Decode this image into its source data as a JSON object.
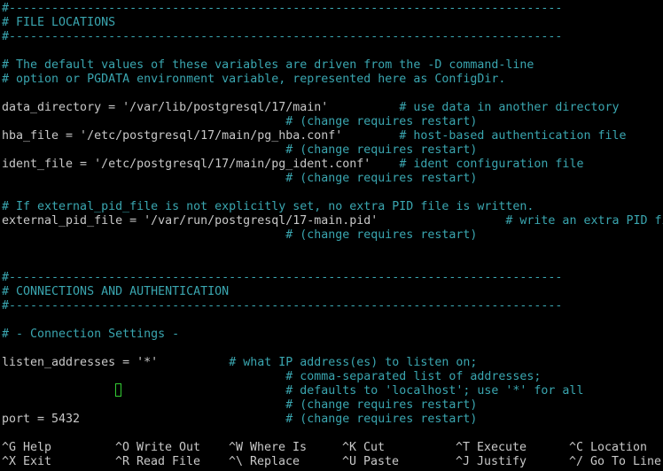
{
  "editor": {
    "lines": [
      {
        "row": 0,
        "type": "comment",
        "text": "#------------------------------------------------------------------------------"
      },
      {
        "row": 1,
        "type": "comment",
        "text": "# FILE LOCATIONS"
      },
      {
        "row": 2,
        "type": "comment",
        "text": "#------------------------------------------------------------------------------"
      },
      {
        "row": 3,
        "type": "blank",
        "text": ""
      },
      {
        "row": 4,
        "type": "comment",
        "text": "# The default values of these variables are driven from the -D command-line"
      },
      {
        "row": 5,
        "type": "comment",
        "text": "# option or PGDATA environment variable, represented here as ConfigDir."
      },
      {
        "row": 6,
        "type": "blank",
        "text": ""
      },
      {
        "row": 7,
        "type": "setting",
        "code": "data_directory = '/var/lib/postgresql/17/main'          ",
        "comment": "# use data in another directory"
      },
      {
        "row": 8,
        "type": "setting",
        "code": "                                        ",
        "comment": "# (change requires restart)"
      },
      {
        "row": 9,
        "type": "setting",
        "code": "hba_file = '/etc/postgresql/17/main/pg_hba.conf'        ",
        "comment": "# host-based authentication file"
      },
      {
        "row": 10,
        "type": "setting",
        "code": "                                        ",
        "comment": "# (change requires restart)"
      },
      {
        "row": 11,
        "type": "setting",
        "code": "ident_file = '/etc/postgresql/17/main/pg_ident.conf'    ",
        "comment": "# ident configuration file"
      },
      {
        "row": 12,
        "type": "setting",
        "code": "                                        ",
        "comment": "# (change requires restart)"
      },
      {
        "row": 13,
        "type": "blank",
        "text": ""
      },
      {
        "row": 14,
        "type": "comment",
        "text": "# If external_pid_file is not explicitly set, no extra PID file is written."
      },
      {
        "row": 15,
        "type": "setting",
        "code": "external_pid_file = '/var/run/postgresql/17-main.pid'                  ",
        "comment": "# write an extra PID file"
      },
      {
        "row": 16,
        "type": "setting",
        "code": "                                        ",
        "comment": "# (change requires restart)"
      },
      {
        "row": 17,
        "type": "blank",
        "text": ""
      },
      {
        "row": 18,
        "type": "blank",
        "text": ""
      },
      {
        "row": 19,
        "type": "comment",
        "text": "#------------------------------------------------------------------------------"
      },
      {
        "row": 20,
        "type": "comment",
        "text": "# CONNECTIONS AND AUTHENTICATION"
      },
      {
        "row": 21,
        "type": "comment",
        "text": "#------------------------------------------------------------------------------"
      },
      {
        "row": 22,
        "type": "blank",
        "text": ""
      },
      {
        "row": 23,
        "type": "comment",
        "text": "# - Connection Settings -"
      },
      {
        "row": 24,
        "type": "blank",
        "text": ""
      },
      {
        "row": 25,
        "type": "setting",
        "code": "listen_addresses = '*'          ",
        "comment": "# what IP address(es) to listen on;"
      },
      {
        "row": 26,
        "type": "setting",
        "code": "                                        ",
        "comment": "# comma-separated list of addresses;"
      },
      {
        "row": 27,
        "type": "setting",
        "code": "                                        ",
        "comment": "# defaults to 'localhost'; use '*' for all"
      },
      {
        "row": 28,
        "type": "setting",
        "code": "                                        ",
        "comment": "# (change requires restart)"
      },
      {
        "row": 29,
        "type": "setting",
        "code": "port = 5432                             ",
        "comment": "# (change requires restart)"
      }
    ]
  },
  "shortcuts": [
    {
      "key": "^G",
      "label": "Help"
    },
    {
      "key": "^O",
      "label": "Write Out"
    },
    {
      "key": "^W",
      "label": "Where Is"
    },
    {
      "key": "^K",
      "label": "Cut"
    },
    {
      "key": "^T",
      "label": "Execute"
    },
    {
      "key": "^C",
      "label": "Location"
    },
    {
      "key": "^X",
      "label": "Exit"
    },
    {
      "key": "^R",
      "label": "Read File"
    },
    {
      "key": "^\\",
      "label": "Replace"
    },
    {
      "key": "^U",
      "label": "Paste"
    },
    {
      "key": "^J",
      "label": "Justify"
    },
    {
      "key": "^/",
      "label": "Go To Line"
    }
  ],
  "colors": {
    "background": "#000000",
    "text": "#c8c8c8",
    "comment": "#3aa6b0",
    "cursor": "#33cc33"
  }
}
